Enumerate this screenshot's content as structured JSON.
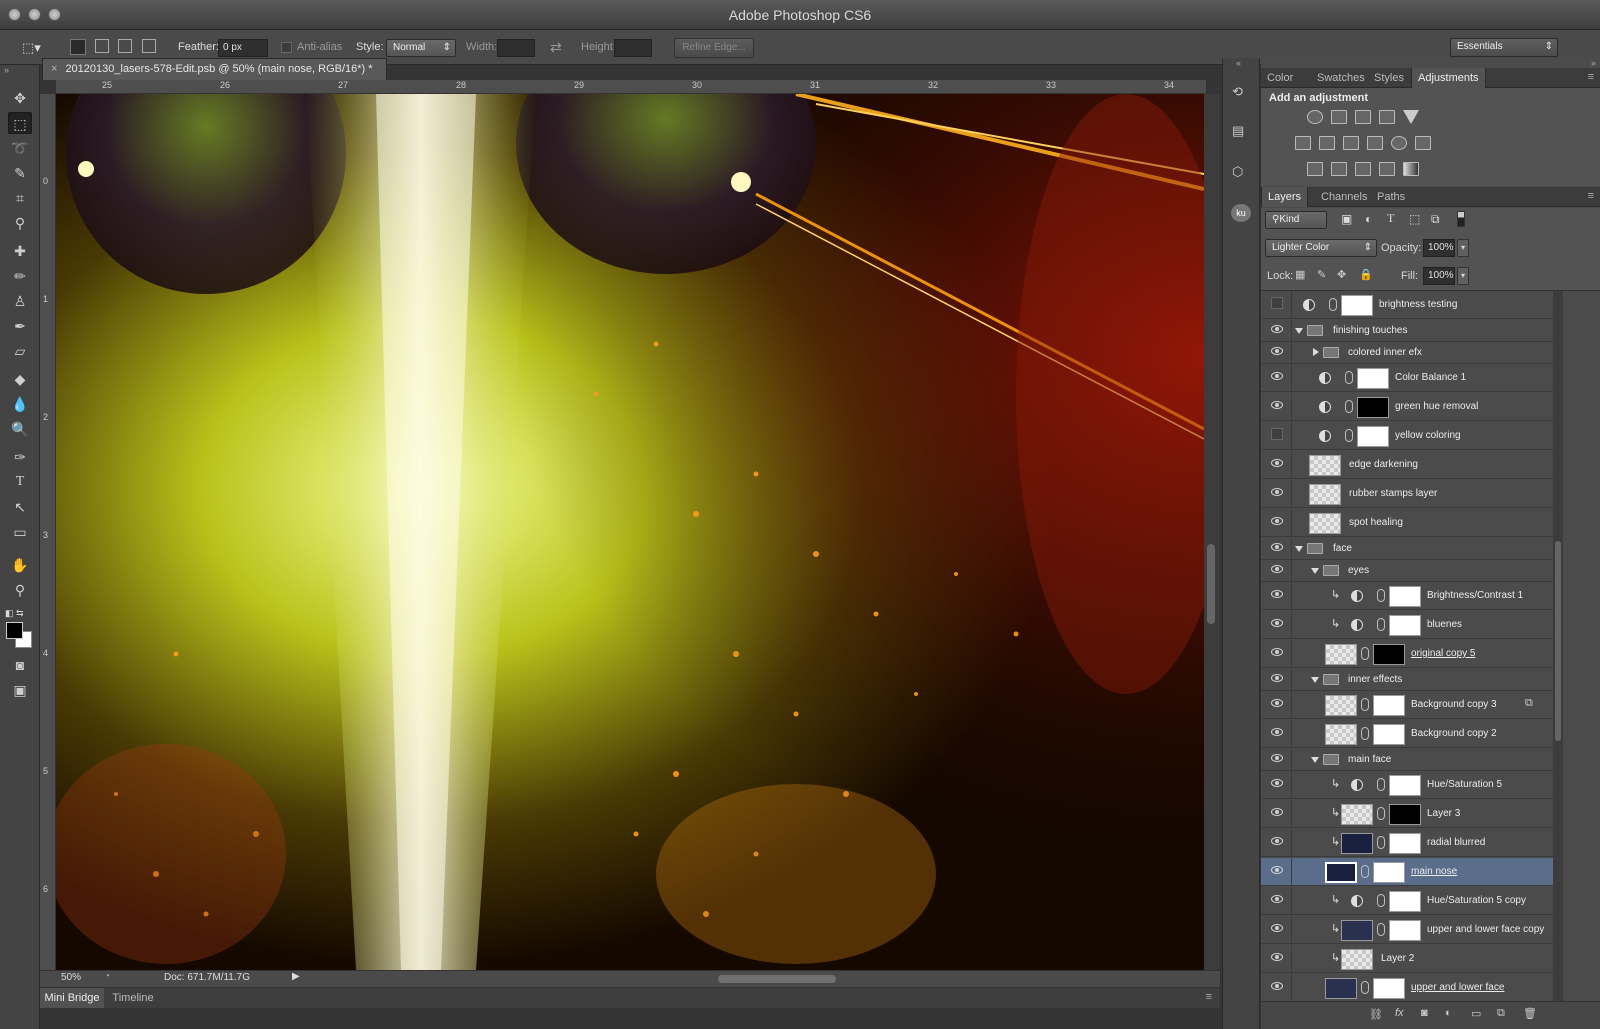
{
  "window": {
    "title": "Adobe Photoshop CS6"
  },
  "options": {
    "feather_label": "Feather:",
    "feather_value": "0 px",
    "antialias_label": "Anti-alias",
    "style_label": "Style:",
    "style_value": "Normal",
    "width_label": "Width:",
    "height_label": "Height:",
    "refine_edge": "Refine Edge...",
    "workspace": "Essentials"
  },
  "document": {
    "tab_title": "20120130_lasers-578-Edit.psb @ 50% (main nose, RGB/16*) *",
    "ruler_h": [
      "25",
      "26",
      "27",
      "28",
      "29",
      "30",
      "31",
      "32",
      "33",
      "34"
    ],
    "ruler_v": [
      "0",
      "1",
      "2",
      "3",
      "4",
      "5",
      "6"
    ]
  },
  "status": {
    "zoom": "50%",
    "doc": "Doc: 671.7M/11.7G"
  },
  "bottom_tabs": [
    "Mini Bridge",
    "Timeline"
  ],
  "adjust_panel": {
    "tabs": [
      "Color",
      "Swatches",
      "Styles",
      "Adjustments"
    ],
    "heading": "Add an adjustment"
  },
  "layers_panel": {
    "tabs": [
      "Layers",
      "Channels",
      "Paths"
    ],
    "kind": "Kind",
    "blend_mode": "Lighter Color",
    "opacity_label": "Opacity:",
    "opacity_value": "100%",
    "lock_label": "Lock:",
    "fill_label": "Fill:",
    "fill_value": "100%",
    "layers": [
      {
        "name": "brightness testing"
      },
      {
        "name": "finishing touches"
      },
      {
        "name": "colored inner efx"
      },
      {
        "name": "Color Balance 1"
      },
      {
        "name": "green hue removal"
      },
      {
        "name": "yellow coloring"
      },
      {
        "name": "edge darkening"
      },
      {
        "name": "rubber stamps layer"
      },
      {
        "name": "spot healing"
      },
      {
        "name": "face"
      },
      {
        "name": "eyes"
      },
      {
        "name": "Brightness/Contrast 1"
      },
      {
        "name": "bluenes"
      },
      {
        "name": "original copy 5"
      },
      {
        "name": "inner effects"
      },
      {
        "name": "Background copy 3"
      },
      {
        "name": "Background copy 2"
      },
      {
        "name": "main face"
      },
      {
        "name": "Hue/Saturation 5"
      },
      {
        "name": "Layer 3"
      },
      {
        "name": "radial blurred"
      },
      {
        "name": "main nose"
      },
      {
        "name": "Hue/Saturation 5 copy"
      },
      {
        "name": "upper and lower face copy"
      },
      {
        "name": "Layer 2"
      },
      {
        "name": "upper and lower face"
      }
    ]
  }
}
